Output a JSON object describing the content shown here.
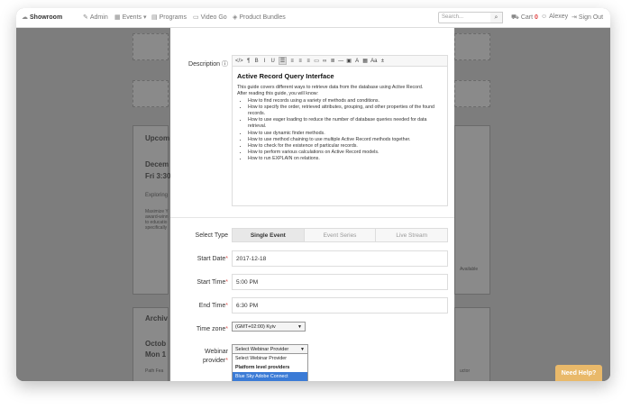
{
  "nav": {
    "brand": "Showroom",
    "admin": "Admin",
    "events": "Events",
    "programs": "Programs",
    "video_go": "Video Go",
    "product_bundles": "Product Bundles",
    "search_placeholder": "Search...",
    "cart_label": "Cart",
    "cart_count": "0",
    "user": "Alexey",
    "sign_out": "Sign Out"
  },
  "background": {
    "upcoming": "Upcom",
    "event_date": "Decem",
    "event_time": "Fri 3:30",
    "exploring": "Exploring",
    "desc_line1": "Maximize Y",
    "desc_line2": "award-winn",
    "desc_line3": "to educatio",
    "desc_line4": "specifically",
    "available": "Available",
    "archive": "Archiv",
    "oct_date": "Octob",
    "oct_time": "Mon 1",
    "path": "Path Fea",
    "instructor": "uctor"
  },
  "form": {
    "description_label": "Description",
    "toolbar": [
      "</>",
      "¶",
      "B",
      "I",
      "U",
      "☰",
      "≡",
      "≡",
      "≡",
      "▭",
      "∞",
      "≣",
      "—",
      "▣",
      "A",
      "▦",
      "Aa",
      "±"
    ],
    "doc": {
      "title": "Active Record Query Interface",
      "intro1": "This guide covers different ways to retrieve data from the database using Active Record.",
      "intro2": "After reading this guide, you will know:",
      "bullets": [
        "How to find records using a variety of methods and conditions.",
        "How to specify the order, retrieved attributes, grouping, and other properties of the found records.",
        "How to use eager loading to reduce the number of database queries needed for data retrieval.",
        "How to use dynamic finder methods.",
        "How to use method chaining to use multiple Active Record methods together.",
        "How to check for the existence of particular records.",
        "How to perform various calculations on Active Record models.",
        "How to run EXPLAIN on relations."
      ]
    },
    "select_type_label": "Select Type",
    "types": [
      "Single Event",
      "Event Series",
      "Live Stream"
    ],
    "start_date_label": "Start Date",
    "start_date": "2017-12-18",
    "start_time_label": "Start Time",
    "start_time": "5:00 PM",
    "end_time_label": "End Time",
    "end_time": "6:30 PM",
    "timezone_label": "Time zone",
    "timezone": "(GMT+02:00) Kyiv",
    "webinar_label_1": "Webinar",
    "webinar_label_2": "provider",
    "webinar_select": "Select Webinar Provider",
    "dropdown": {
      "placeholder": "Select Webinar Provider",
      "group": "Platform level providers",
      "option": "Blue Sky Adobe Connect"
    }
  },
  "help_button": "Need Help?"
}
